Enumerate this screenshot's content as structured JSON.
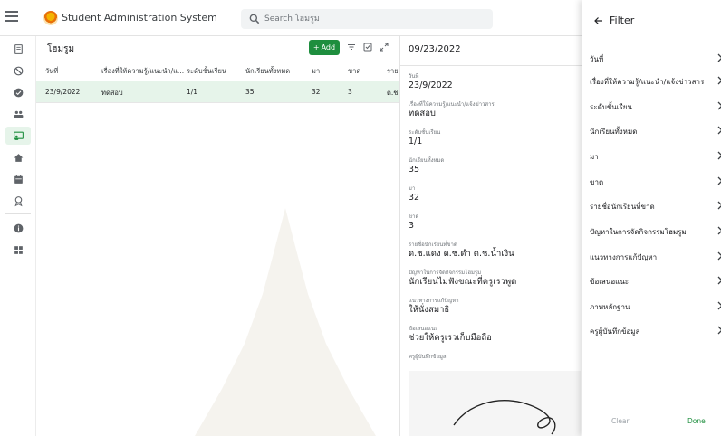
{
  "app": {
    "title": "Student Administration System",
    "search_placeholder": "Search โฮมรูม",
    "accent_color": "#1e8e3e"
  },
  "rail": {
    "items": [
      {
        "name": "document-icon"
      },
      {
        "name": "block-icon"
      },
      {
        "name": "check-circle-icon"
      },
      {
        "name": "people-icon"
      },
      {
        "name": "classroom-icon",
        "active": true
      },
      {
        "name": "home-icon"
      },
      {
        "name": "calendar-icon"
      },
      {
        "name": "badge-icon"
      },
      {
        "name": "info-icon"
      },
      {
        "name": "grid-icon"
      }
    ]
  },
  "list": {
    "title": "โฮมรูม",
    "add_label": "Add",
    "columns": [
      "วันที่",
      "เรื่องที่ให้ความรู้/แนะนำ/แ...",
      "ระดับชั้นเรียน",
      "นักเรียนทั้งหมด",
      "มา",
      "ขาด",
      "รายชื่"
    ],
    "rows": [
      {
        "cells": [
          "23/9/2022",
          "ทดสอบ",
          "1/1",
          "35",
          "32",
          "3",
          "ด.ช.แ"
        ]
      }
    ]
  },
  "detail": {
    "title": "09/23/2022",
    "fields": [
      {
        "label": "วันที่",
        "value": "23/9/2022"
      },
      {
        "label": "เรื่องที่ให้ความรู้/แนะนำ/แจ้งข่าวสาร",
        "value": "ทดสอบ"
      },
      {
        "label": "ระดับชั้นเรียน",
        "value": "1/1"
      },
      {
        "label": "นักเรียนทั้งหมด",
        "value": "35"
      },
      {
        "label": "มา",
        "value": "32"
      },
      {
        "label": "ขาด",
        "value": "3"
      },
      {
        "label": "รายชื่อนักเรียนที่ขาด",
        "value": "ด.ช.แดง ด.ช.ดำ ด.ช.น้ำเงิน"
      },
      {
        "label": "ปัญหาในการจัดกิจกรรมโฮมรูม",
        "value": "นักเรียนไม่ฟังขณะที่ครูเรวพูด"
      },
      {
        "label": "แนวทางการแก้ปัญหา",
        "value": "ให้นั่งสมาธิ"
      },
      {
        "label": "ข้อเสนอแนะ",
        "value": "ช่วยให้ครูเรวเก็บมือถือ"
      },
      {
        "label": "ครูผู้บันทึกข้อมูล",
        "value": ""
      }
    ]
  },
  "filter": {
    "title": "Filter",
    "items": [
      "วันที่",
      "เรื่องที่ให้ความรู้/แนะนำ/แจ้งข่าวสาร",
      "ระดับชั้นเรียน",
      "นักเรียนทั้งหมด",
      "มา",
      "ขาด",
      "รายชื่อนักเรียนที่ขาด",
      "ปัญหาในการจัดกิจกรรมโฮมรูม",
      "แนวทางการแก้ปัญหา",
      "ข้อเสนอแนะ",
      "ภาพหลักฐาน",
      "ครูผู้บันทึกข้อมูล"
    ],
    "clear_label": "Clear",
    "done_label": "Done"
  }
}
